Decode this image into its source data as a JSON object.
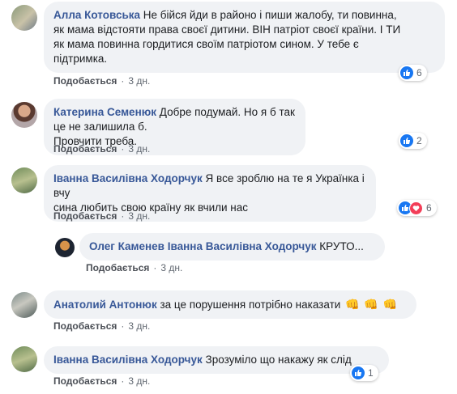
{
  "comments": [
    {
      "author": "Алла Котовська",
      "text_lines": [
        "Не бійся йди в районо і пиши жалобу, ти повинна,",
        "як мама відстояти права своєї дитини. ВІН патріот своєї країни. І ТИ",
        "як мама повинна гордитися своїм патріотом сином. У тебе є",
        "підтримка."
      ],
      "like_label": "Подобається",
      "time": "3 дн.",
      "reactions": 6
    },
    {
      "author": "Катерина Семенюк",
      "text_lines": [
        "Добре подумай. Но я б так це не залишила б.",
        "Провчити треба."
      ],
      "like_label": "Подобається",
      "time": "3 дн.",
      "reactions": 2
    },
    {
      "author": "Іванна Василівна Ходорчук",
      "text_lines": [
        "Я все зроблю на те я Українка і вчу",
        "сина любить свою країну як вчили нас"
      ],
      "like_label": "Подобається",
      "time": "3 дн.",
      "reactions": 6
    },
    {
      "author": "Олег Каменев",
      "mention": "Іванна Василівна Ходорчук",
      "text_lines": [
        "КРУТО..."
      ],
      "like_label": "Подобається",
      "time": "3 дн."
    },
    {
      "author": "Анатолий Антонюк",
      "text_lines": [
        "за це порушення потрібно наказати"
      ],
      "emojis": [
        "👊",
        "👊",
        "👊"
      ],
      "like_label": "Подобається",
      "time": "3 дн."
    },
    {
      "author": "Іванна Василівна Ходорчук",
      "text_lines": [
        "Зрозуміло що накажу як слід"
      ],
      "like_label": "Подобається",
      "time": "3 дн.",
      "reactions": 1
    }
  ],
  "colors": {
    "author": "#385898",
    "bubble": "#f0f2f5",
    "like": "#1877f2",
    "love": "#f33e58"
  }
}
